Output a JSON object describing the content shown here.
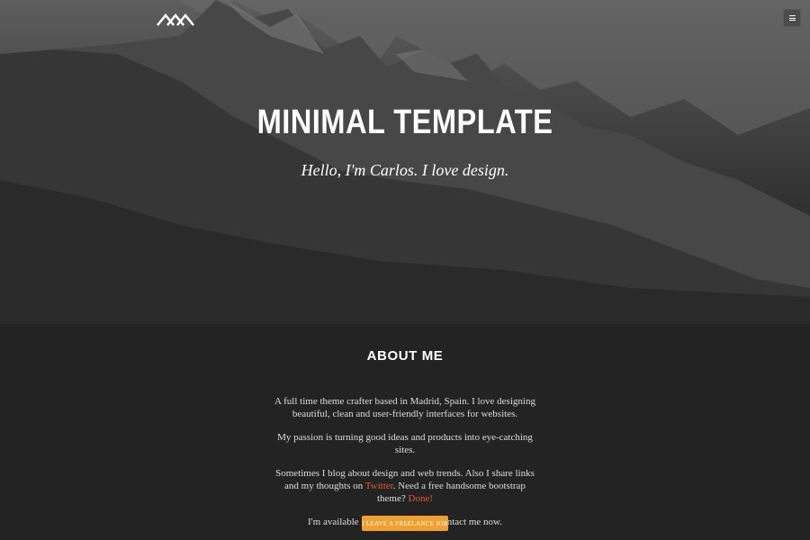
{
  "header": {
    "logo_icon": "mountain-logo-icon",
    "menu_icon": "hamburger-menu-icon"
  },
  "hero": {
    "title": "MINIMAL TEMPLATE",
    "tagline": "Hello, I'm Carlos. I love design."
  },
  "about": {
    "heading": "ABOUT ME",
    "paragraph_1": "A full time theme crafter based in Madrid, Spain. I love designing beautiful, clean and user-friendly interfaces for websites.",
    "paragraph_2": "My passion is turning good ideas and products into eye-catching sites.",
    "paragraph_3_before_link": "Sometimes I blog about design and web trends. Also I share links and my thoughts on ",
    "twitter_link": "Twitter",
    "paragraph_3_middle": ". Need a free handsome bootstrap theme? ",
    "done_link": "Done!",
    "paragraph_4": "I'm available for freelance jobs. Contact me now.",
    "cta_label": "I LEAVE A FREELANCE JOB"
  },
  "colors": {
    "background": "#232323",
    "link_accent": "#e35a32",
    "button_accent": "#f0a030"
  }
}
